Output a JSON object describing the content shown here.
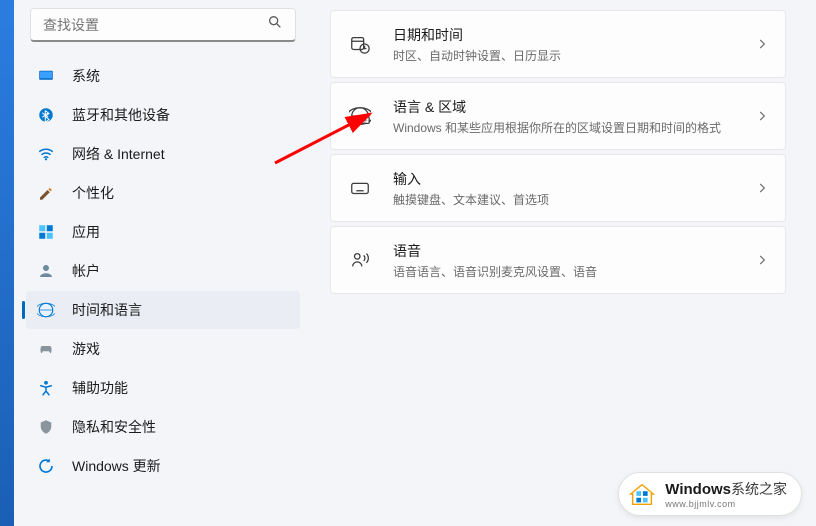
{
  "search": {
    "placeholder": "查找设置"
  },
  "sidebar": {
    "items": [
      {
        "label": "系统"
      },
      {
        "label": "蓝牙和其他设备"
      },
      {
        "label": "网络 & Internet"
      },
      {
        "label": "个性化"
      },
      {
        "label": "应用"
      },
      {
        "label": "帐户"
      },
      {
        "label": "时间和语言"
      },
      {
        "label": "游戏"
      },
      {
        "label": "辅助功能"
      },
      {
        "label": "隐私和安全性"
      },
      {
        "label": "Windows 更新"
      }
    ]
  },
  "cards": [
    {
      "title": "日期和时间",
      "desc": "时区、自动时钟设置、日历显示"
    },
    {
      "title": "语言 & 区域",
      "desc": "Windows 和某些应用根据你所在的区域设置日期和时间的格式"
    },
    {
      "title": "输入",
      "desc": "触摸键盘、文本建议、首选项"
    },
    {
      "title": "语音",
      "desc": "语音语言、语音识别麦克风设置、语音"
    }
  ],
  "watermark": {
    "brand": "Windows",
    "brand2": "系统之家",
    "url": "www.bjjmlv.com"
  }
}
